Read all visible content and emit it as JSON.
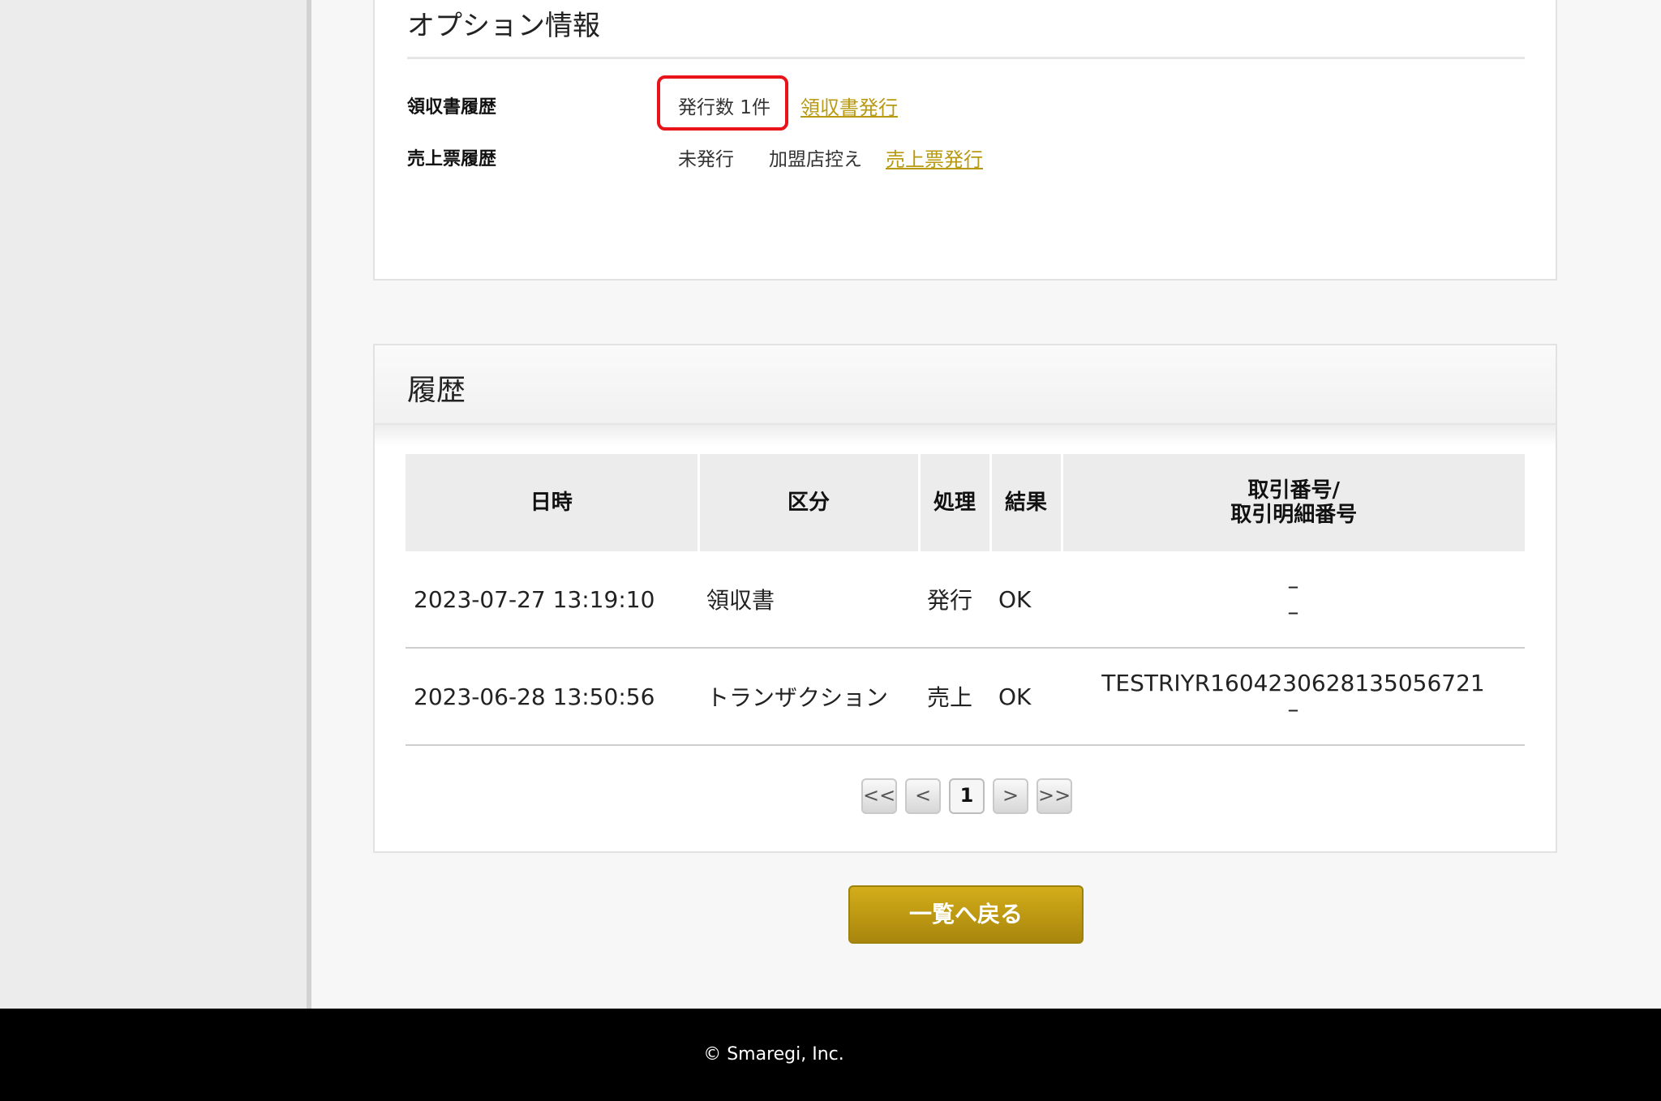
{
  "options": {
    "title": "オプション情報",
    "receipt_label": "領収書履歴",
    "receipt_count": "発行数 1件",
    "receipt_issue_link": "領収書発行",
    "sales_label": "売上票履歴",
    "sales_status": "未発行",
    "sales_merchant_copy": "加盟店控え",
    "sales_issue_link": "売上票発行"
  },
  "history": {
    "title": "履歴",
    "columns": {
      "datetime": "日時",
      "category": "区分",
      "process": "処理",
      "result": "結果",
      "txn_line1": "取引番号/",
      "txn_line2": "取引明細番号"
    },
    "rows": [
      {
        "datetime": "2023-07-27 13:19:10",
        "category": "領収書",
        "process": "発行",
        "result": "OK",
        "txn_no": "–",
        "txn_detail_no": "–"
      },
      {
        "datetime": "2023-06-28 13:50:56",
        "category": "トランザクション",
        "process": "売上",
        "result": "OK",
        "txn_no": "TESTRIYR1604230628135056721",
        "txn_detail_no": "–"
      }
    ]
  },
  "pager": {
    "first": "<<",
    "prev": "<",
    "current": "1",
    "next": ">",
    "last": ">>"
  },
  "back_button": "一覧へ戻る",
  "footer": {
    "copyright": "© Smaregi, Inc."
  },
  "colors": {
    "link": "#b79a12",
    "button": "#c19d14",
    "highlight": "#e8141a"
  }
}
